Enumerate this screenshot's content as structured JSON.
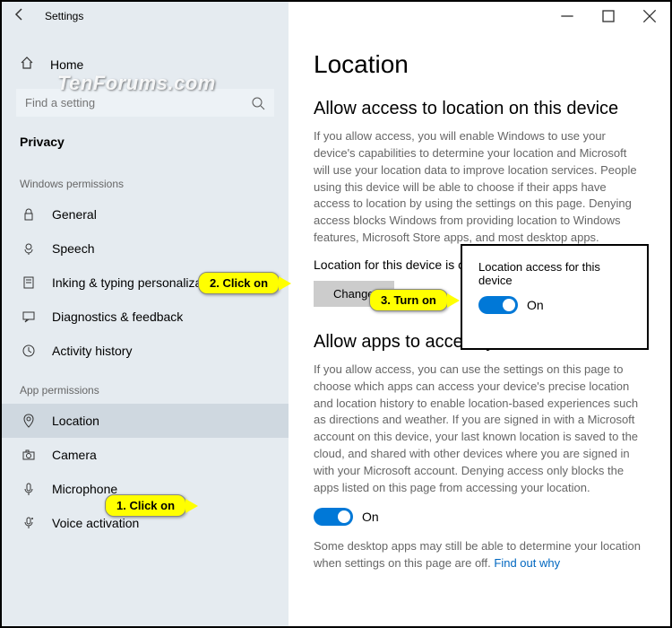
{
  "window": {
    "title": "Settings"
  },
  "watermark": "TenForums.com",
  "sidebar": {
    "home": "Home",
    "search_placeholder": "Find a setting",
    "section": "Privacy",
    "group1": "Windows permissions",
    "items1": [
      {
        "label": "General"
      },
      {
        "label": "Speech"
      },
      {
        "label": "Inking & typing personalization"
      },
      {
        "label": "Diagnostics & feedback"
      },
      {
        "label": "Activity history"
      }
    ],
    "group2": "App permissions",
    "items2": [
      {
        "label": "Location"
      },
      {
        "label": "Camera"
      },
      {
        "label": "Microphone"
      },
      {
        "label": "Voice activation"
      }
    ]
  },
  "content": {
    "h1": "Location",
    "h2a": "Allow access to location on this device",
    "p1": "If you allow access, you will enable Windows to use your device's capabilities to determine your location and Microsoft will use your location data to improve location services. People using this device will be able to choose if their apps have access to location by using the settings on this page. Denying access blocks Windows from providing location to Windows features, Microsoft Store apps, and most desktop apps.",
    "status": "Location for this device is on",
    "change": "Change",
    "h2b": "Allow apps to access your location",
    "p2": "If you allow access, you can use the settings on this page to choose which apps can access your device's precise location and location history to enable location-based experiences such as directions and weather. If you are signed in with a Microsoft account on this device, your last known location is saved to the cloud, and shared with other devices where you are signed in with your Microsoft account. Denying access only blocks the apps listed on this page from accessing your location.",
    "toggle_on": "On",
    "note": "Some desktop apps may still be able to determine your location when settings on this page are off. ",
    "link": "Find out why"
  },
  "popup": {
    "title": "Location access for this device",
    "toggle": "On"
  },
  "callouts": {
    "c1": "1. Click on",
    "c2": "2. Click on",
    "c3": "3. Turn on"
  }
}
